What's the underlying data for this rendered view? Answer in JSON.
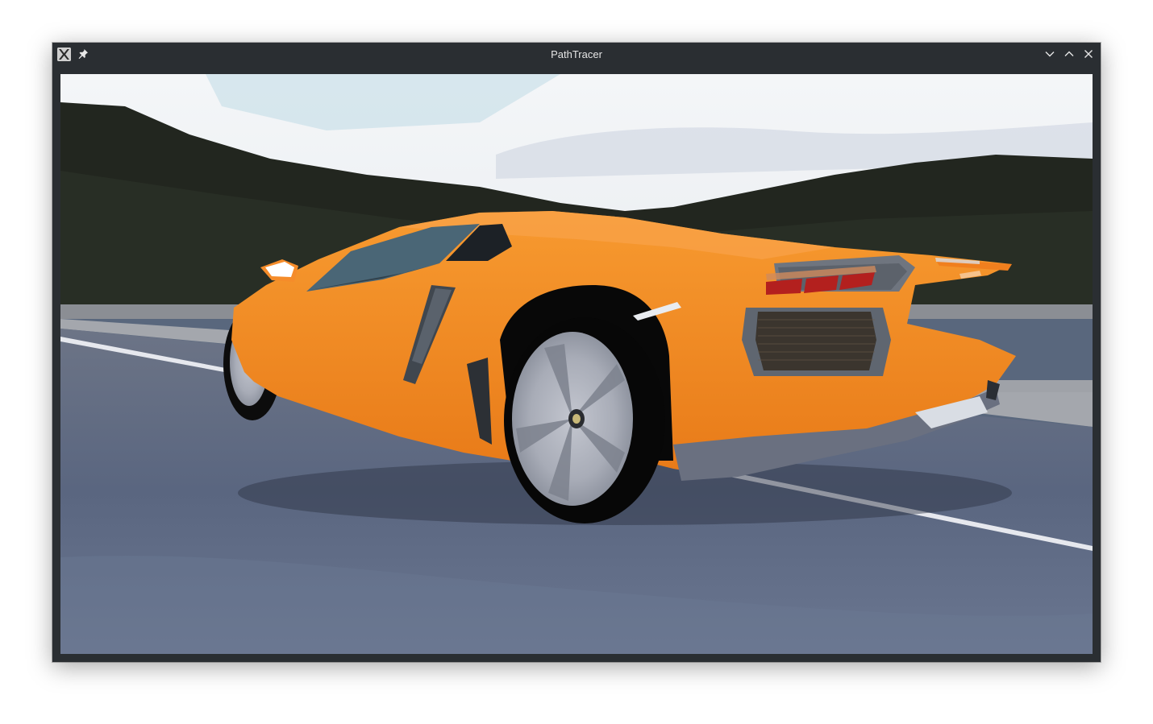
{
  "window": {
    "title": "PathTracer"
  },
  "titlebar_icons": {
    "app": "x-window-app-icon",
    "pin": "pin-icon",
    "minimize": "chevron-down-icon",
    "maximize": "chevron-up-icon",
    "close": "close-icon"
  },
  "render": {
    "description_colors": {
      "car_body": "#f28a22",
      "sky": "#e9eef3",
      "hills": "#22261f",
      "road": "#5b6680",
      "curb": "#8a8d93"
    }
  }
}
